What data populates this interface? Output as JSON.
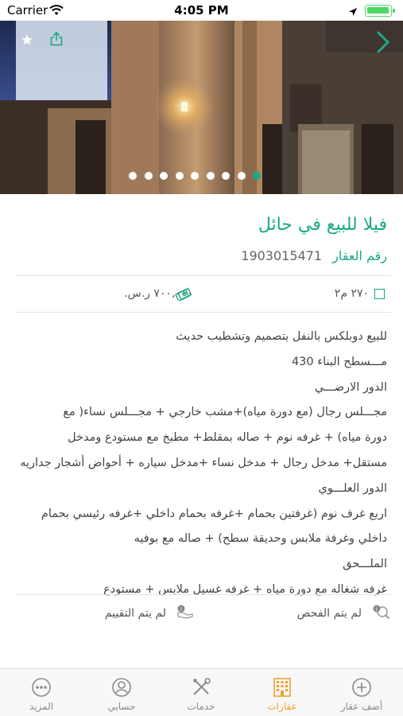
{
  "status_bar": {
    "carrier": "Carrier",
    "time": "4:05 PM"
  },
  "hero": {
    "slide_count": 9,
    "active_slide": 9,
    "icons": [
      "star-icon",
      "share-icon",
      "chevron-right-icon"
    ]
  },
  "listing": {
    "title": "فيلا للبيع في حائل",
    "ref_label": "رقم العقار",
    "ref_number": "1903015471",
    "area": "٢٧٠ م٢",
    "price": "٧٠٠,٠٠٠ ر.س.",
    "description": [
      "للبيع دوبلكس بالنفل بتصميم وتشطيب حديث",
      "مـــسطح البناء 430",
      "الدور الارضـــي",
      "مجـــلس رجال (مع دورة مياه)+مشب خارجي + مجـــلس نساء( مع",
      "دورة مياه) + غرفه نوم + صاله بمقلط+ مطبخ مع مستودع ومدخل",
      "مستقل+ مدخل رجال + مدخل نساء +مدخل سياره + أحواض أشجار جداريه",
      "الدور العلـــوي",
      "اربع غرف نوم (غرفتين بحمام +غرفه بحمام داخلي +غرفه رئيسي بحمام",
      "داخلي وغرفة ملابس وحديقة سطح) + صاله مع بوفيه",
      "الملـــحق",
      "غرفه شغاله مع دورة مياه + غرفه غسيل ملابس + مستودع"
    ],
    "inspection_status": "لم يتم الفحص",
    "rating_status": "لم يتم التقييم"
  },
  "tabbar": {
    "add": "أضف عقار",
    "properties": "عقارات",
    "services": "خدمات",
    "account": "حسابي",
    "more": "المزيد"
  },
  "colors": {
    "accent": "#1aa987",
    "active_tab": "#f0a030"
  }
}
